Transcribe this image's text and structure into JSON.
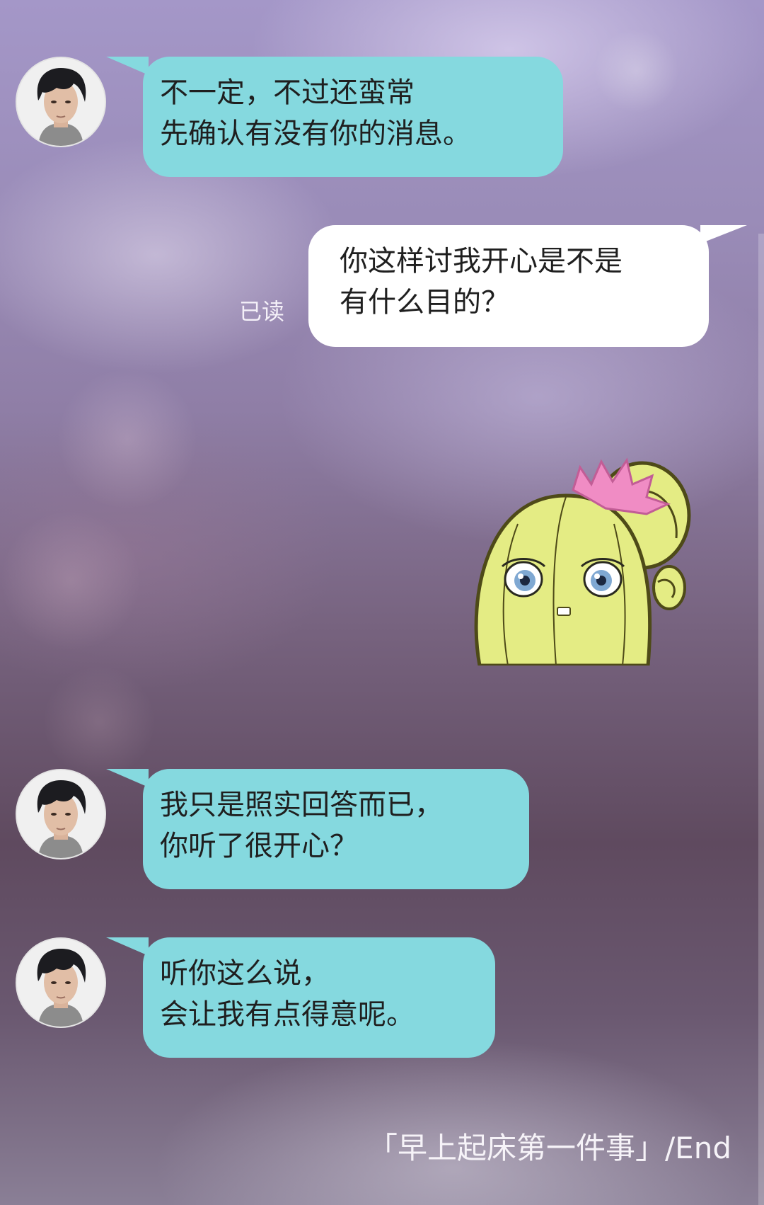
{
  "conversation": {
    "messages": [
      {
        "side": "incoming",
        "sender_avatar": "dark-haired-man-avatar",
        "text": "不一定，不过还蛮常\n先确认有没有你的消息。"
      },
      {
        "side": "outgoing",
        "read_status": "已读",
        "text": "你这样讨我开心是不是\n有什么目的？"
      },
      {
        "side": "outgoing",
        "type": "sticker",
        "sticker_icon": "cactus-girl-sticker"
      },
      {
        "side": "incoming",
        "sender_avatar": "dark-haired-man-avatar",
        "text": "我只是照实回答而已，\n你听了很开心？"
      },
      {
        "side": "incoming",
        "sender_avatar": "dark-haired-man-avatar",
        "text": "听你这么说，\n会让我有点得意呢。"
      }
    ]
  },
  "footer": {
    "text": "「早上起床第一件事」/End"
  },
  "colors": {
    "incoming_bubble": "#85d9df",
    "outgoing_bubble": "#ffffff",
    "sticker_body": "#e4ec84",
    "sticker_flower": "#f08cc4"
  }
}
